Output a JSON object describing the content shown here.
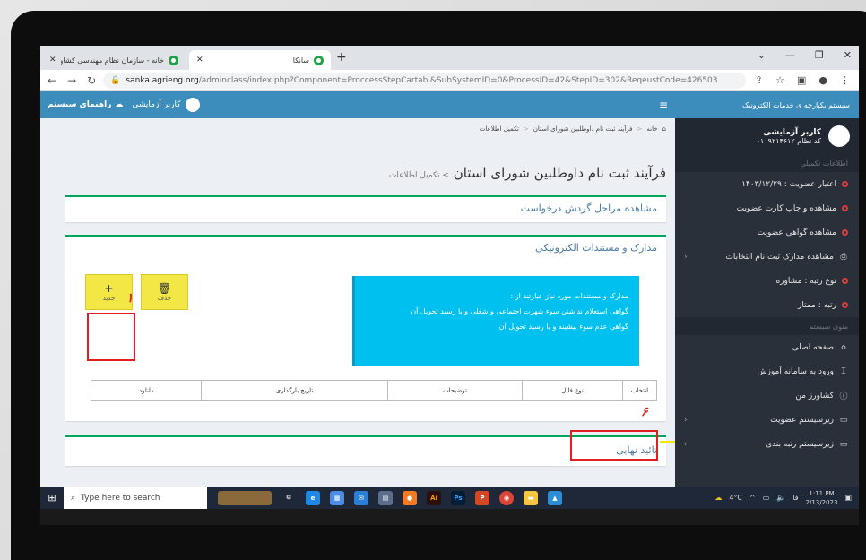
{
  "browser": {
    "tabs": [
      {
        "title": "سانکا",
        "active": true
      },
      {
        "title": "خانه - سازمان نظام مهندسی کشاو...",
        "active": false
      }
    ],
    "url_domain": "sanka.agrieng.org",
    "url_path": "/adminclass/index.php?Component=ProccessStepCartabl&SubSystemID=0&ProcessID=42&StepID=302&ReqeustCode=426503"
  },
  "sidebar": {
    "header": "سیستم یکپارچه ی خدمات الکترونیک",
    "user_name": "کاربر آزمایشی",
    "user_code": "کد نظام ۰۱۰۹۲۱۴۶۱۲",
    "section_info": "اطلاعات تکمیلی",
    "info_items": [
      "اعتبار عضویت : ۱۴۰۳/۱۲/۲۹",
      "مشاهده و چاپ کارت عضویت",
      "مشاهده گواهی عضویت",
      "مشاهده مدارک ثبت نام انتخابات",
      "نوع رتبه : مشاوره",
      "رتبه : ممتاز"
    ],
    "section_menu": "منوی سیستم",
    "menu_items": [
      "صفحه اصلی",
      "ورود به سامانه آموزش",
      "کشاورز من",
      "زیرسیستم عضویت",
      "زیرسیستم رتبه بندی"
    ]
  },
  "topnav": {
    "guide": "راهنمای سیستم",
    "user": "کاربر آزمایشی"
  },
  "breadcrumb": {
    "home": "خانه",
    "step1": "فرآیند ثبت نام داوطلبین شورای استان",
    "step2": "تکمیل اطلاعات"
  },
  "page": {
    "title": "فرآیند ثبت نام داوطلبین شورای استان",
    "subtitle": "> تکمیل اطلاعات"
  },
  "box_steps": {
    "title": "مشاهده مراحل گردش درخواست"
  },
  "box_docs": {
    "title": "مدارک و مستندات الکترونیکی",
    "new_label": "جدید",
    "delete_label": "حذف",
    "info_lines": [
      "مدارک و مستندات مورد نیاز عبارتند از :",
      "گواهی استعلام نداشتن سوء شهرت اجتماعی و شغلی و یا رسید تحویل آن",
      "گواهی عدم سوء پیشینه و یا رسید تحویل آن"
    ],
    "columns": [
      "انتخاب",
      "نوع فایل",
      "توضیحات",
      "تاریخ بارگذاری",
      "دانلود"
    ]
  },
  "box_final": {
    "title": "تائید نهایی"
  },
  "annotations": {
    "mark1": "۱",
    "mark6": "۶"
  },
  "taskbar": {
    "search_placeholder": "Type here to search",
    "weather": "4°C",
    "lang": "فا",
    "time": "1:11 PM",
    "date": "2/13/2023"
  },
  "colors": {
    "sidebar_bg": "#2a3039",
    "header_blue": "#3c8dbc",
    "box_green": "#00a65a",
    "info_cyan": "#00c0ef",
    "button_yellow": "#f3e745",
    "annotation_red": "#e02020"
  }
}
